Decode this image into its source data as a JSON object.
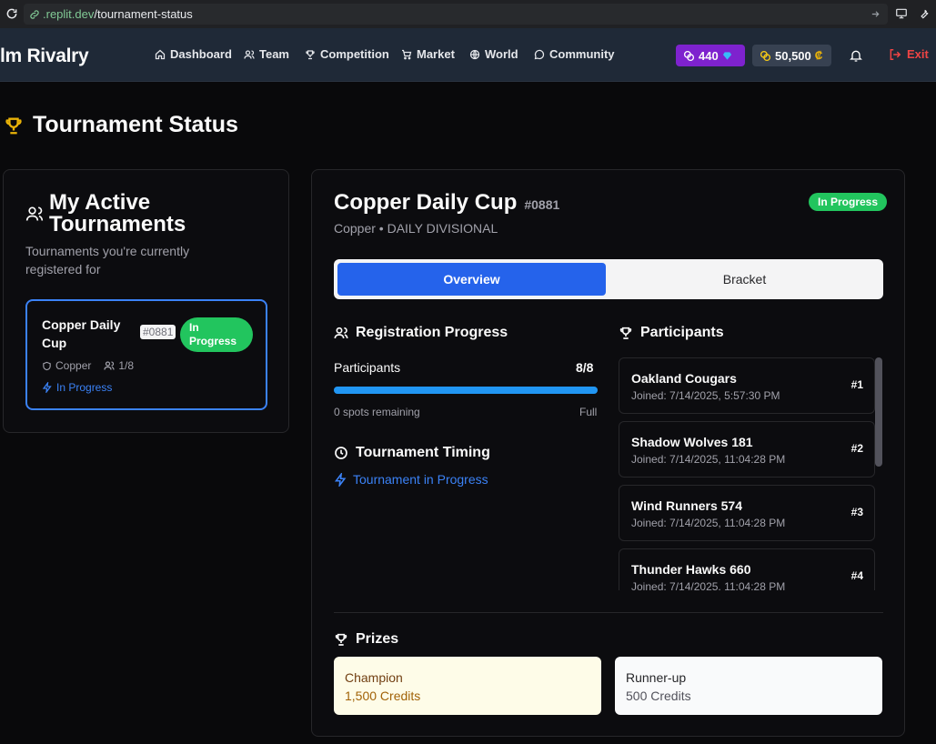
{
  "browser": {
    "url_host": ".replit.dev",
    "url_path": "/tournament-status"
  },
  "nav": {
    "brand": "lm Rivalry",
    "items": [
      {
        "label": "Dashboard",
        "icon": "home-icon"
      },
      {
        "label": "Team",
        "icon": "users-icon"
      },
      {
        "label": "Competition",
        "icon": "trophy-icon"
      },
      {
        "label": "Market",
        "icon": "cart-icon"
      },
      {
        "label": "World",
        "icon": "globe-icon"
      },
      {
        "label": "Community",
        "icon": "chat-icon"
      }
    ],
    "gems": "440",
    "coins": "50,500",
    "exit_label": "Exit"
  },
  "page": {
    "title": "Tournament Status"
  },
  "active": {
    "title": "My Active Tournaments",
    "subtitle": "Tournaments you're currently registered for",
    "card": {
      "name": "Copper Daily Cup",
      "id": "#0881",
      "badge": "In Progress",
      "division": "Copper",
      "count": "1/8",
      "status": "In Progress"
    }
  },
  "detail": {
    "title": "Copper Daily Cup",
    "id": "#0881",
    "badge": "In Progress",
    "subtitle": "Copper • DAILY DIVISIONAL",
    "tabs": [
      "Overview",
      "Bracket"
    ],
    "registration": {
      "heading": "Registration Progress",
      "label": "Participants",
      "value": "8/8",
      "progress": 1.0,
      "remaining": "0 spots remaining",
      "state": "Full"
    },
    "timing": {
      "heading": "Tournament Timing",
      "status": "Tournament in Progress"
    },
    "participants": {
      "heading": "Participants",
      "list": [
        {
          "name": "Oakland Cougars",
          "joined": "Joined: 7/14/2025, 5:57:30 PM",
          "rank": "#1"
        },
        {
          "name": "Shadow Wolves 181",
          "joined": "Joined: 7/14/2025, 11:04:28 PM",
          "rank": "#2"
        },
        {
          "name": "Wind Runners 574",
          "joined": "Joined: 7/14/2025, 11:04:28 PM",
          "rank": "#3"
        },
        {
          "name": "Thunder Hawks 660",
          "joined": "Joined: 7/14/2025, 11:04:28 PM",
          "rank": "#4"
        }
      ]
    },
    "prizes": {
      "heading": "Prizes",
      "champion": {
        "label": "Champion",
        "value": "1,500 Credits"
      },
      "runner_up": {
        "label": "Runner-up",
        "value": "500 Credits"
      }
    }
  },
  "colors": {
    "accent": "#2563eb",
    "success": "#22c55e",
    "gold": "#eab308",
    "danger": "#ef4444"
  }
}
